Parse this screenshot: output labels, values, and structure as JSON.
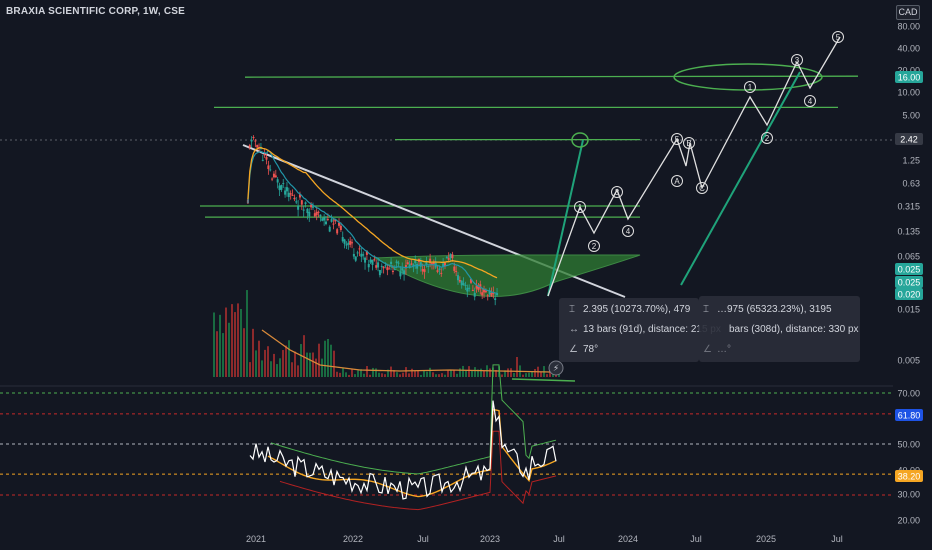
{
  "header": {
    "title": "BRAXIA SCIENTIFIC CORP, 1W, CSE",
    "currency": "CAD"
  },
  "colors": {
    "background": "#131722",
    "axis_text": "#b2b5be",
    "up_candle": "#26a69a",
    "down_candle": "#ef5350",
    "trendline": "#d1d4dc",
    "wave_lines": "#4caf50",
    "ma_orange": "#f5a623",
    "rsi_line": "#ffffff",
    "rsi_green": "#4caf50",
    "rsi_red": "#b22222",
    "tag_green": "#26a69a",
    "tag_blue": "#1e53e5",
    "tag_orange": "#f5a623",
    "tag_white": "#ffffff"
  },
  "price_axis": {
    "scale": "log",
    "ticks": [
      "80.00",
      "40.00",
      "20.00",
      "10.00",
      "5.00",
      "2.42",
      "1.25",
      "0.63",
      "0.315",
      "0.135",
      "0.065",
      "0.025",
      "0.025",
      "0.020",
      "0.015",
      "0.005"
    ],
    "tags": [
      {
        "label": "16.00",
        "style": "green"
      },
      {
        "label": "2.42",
        "style": "dark"
      },
      {
        "label": "0.025",
        "style": "green"
      },
      {
        "label": "0.025",
        "style": "green"
      },
      {
        "label": "0.020",
        "style": "green"
      }
    ]
  },
  "rsi_axis": {
    "ticks": [
      "70.00",
      "50.00",
      "40.00",
      "30.00",
      "20.00"
    ],
    "tags": [
      {
        "label": "61.80",
        "style": "blue"
      },
      {
        "label": "38.20",
        "style": "orange"
      }
    ]
  },
  "time_axis": {
    "labels": [
      "2021",
      "2022",
      "Jul",
      "2023",
      "Jul",
      "2024",
      "Jul",
      "2025",
      "Jul"
    ]
  },
  "wave_labels": {
    "projection_1": [
      "1",
      "2",
      "3",
      "4",
      "5",
      "B",
      "A",
      "C"
    ],
    "projection_2": [
      "1",
      "2",
      "3",
      "4",
      "5"
    ]
  },
  "measure_tooltips": [
    {
      "price_row": "2.395 (10273.70%), 479",
      "bars_row": "13 bars (91d), distance: 215 px",
      "angle_row": "78°"
    },
    {
      "price_row": "…975 (65323.23%), 3195",
      "bars_row": "bars (308d), distance: 330 px",
      "angle_row": "…°"
    }
  ],
  "chart_data": {
    "type": "line",
    "title": "BRAXIA SCIENTIFIC CORP, 1W, CSE",
    "yscale": "log",
    "ylim": [
      0.005,
      80
    ],
    "x": [
      "2021",
      "2022",
      "Jul",
      "2023",
      "Jul",
      "2024",
      "Jul",
      "2025",
      "Jul"
    ],
    "series": [
      {
        "name": "",
        "points": [
          [
            "2020-12",
            0.32
          ],
          [
            "2020-12",
            2.0
          ],
          [
            "2021-01",
            2.35
          ],
          [
            "2021-02",
            1.4
          ],
          [
            "2021-03",
            0.8
          ],
          [
            "2021-05",
            0.45
          ],
          [
            "2021-07",
            0.33
          ],
          [
            "2021-09",
            0.22
          ],
          [
            "2021-11",
            0.16
          ],
          [
            "2022-01",
            0.085
          ],
          [
            "2022-03",
            0.055
          ],
          [
            "2022-06",
            0.048
          ],
          [
            "2022-09",
            0.05
          ],
          [
            "2022-12",
            0.045
          ],
          [
            "2023-01",
            0.07
          ],
          [
            "2023-02",
            0.033
          ],
          [
            "2023-04",
            0.024
          ],
          [
            "2023-06",
            0.021
          ],
          [
            "2023-07",
            0.02
          ]
        ]
      }
    ],
    "horizontal_levels": [
      16.0,
      6.5,
      2.4,
      0.31,
      0.22
    ],
    "rsi": {
      "ylim": [
        15,
        78
      ],
      "levels": [
        70,
        61.8,
        50,
        38.2,
        30
      ],
      "tags": [
        "61.80",
        "38.20"
      ]
    }
  }
}
